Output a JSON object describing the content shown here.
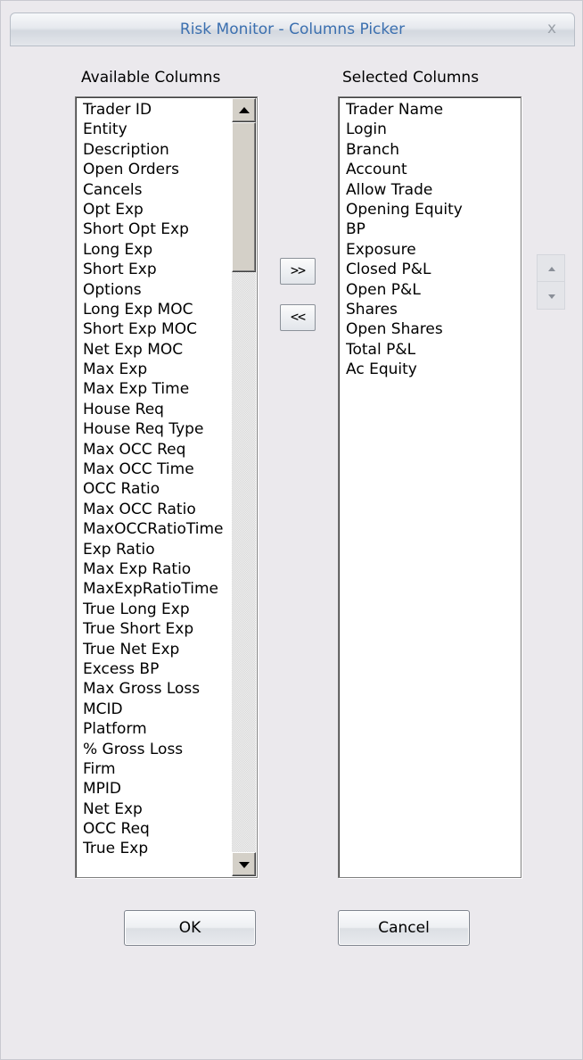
{
  "window": {
    "title": "Risk Monitor - Columns Picker",
    "close_glyph": "x"
  },
  "available": {
    "label": "Available Columns",
    "items": [
      {
        "label": "Trader ID"
      },
      {
        "label": "Entity"
      },
      {
        "label": "Description"
      },
      {
        "label": "Open Orders"
      },
      {
        "label": "Cancels"
      },
      {
        "label": "Opt Exp"
      },
      {
        "label": "Short Opt Exp"
      },
      {
        "label": "Long Exp"
      },
      {
        "label": "Short Exp"
      },
      {
        "label": "Options"
      },
      {
        "label": "Long Exp MOC"
      },
      {
        "label": "Short Exp MOC"
      },
      {
        "label": "Net Exp MOC"
      },
      {
        "label": "Max Exp"
      },
      {
        "label": "Max Exp Time"
      },
      {
        "label": "House Req"
      },
      {
        "label": "House Req Type"
      },
      {
        "label": "Max OCC Req"
      },
      {
        "label": "Max OCC Time"
      },
      {
        "label": "OCC Ratio"
      },
      {
        "label": "Max OCC Ratio"
      },
      {
        "label": "MaxOCCRatioTime"
      },
      {
        "label": "Exp Ratio"
      },
      {
        "label": "Max Exp Ratio"
      },
      {
        "label": "MaxExpRatioTime"
      },
      {
        "label": "True Long Exp"
      },
      {
        "label": "True Short Exp"
      },
      {
        "label": "True Net Exp"
      },
      {
        "label": "Excess BP"
      },
      {
        "label": "Max Gross Loss"
      },
      {
        "label": "MCID"
      },
      {
        "label": "Platform"
      },
      {
        "label": "% Gross Loss"
      },
      {
        "label": "Firm"
      },
      {
        "label": "MPID"
      },
      {
        "label": "Net Exp"
      },
      {
        "label": "OCC Req"
      },
      {
        "label": "True Exp"
      }
    ]
  },
  "selected": {
    "label": "Selected Columns",
    "items": [
      {
        "label": "Trader Name"
      },
      {
        "label": "Login"
      },
      {
        "label": "Branch"
      },
      {
        "label": "Account"
      },
      {
        "label": "Allow Trade"
      },
      {
        "label": "Opening Equity"
      },
      {
        "label": "BP"
      },
      {
        "label": "Exposure"
      },
      {
        "label": "Closed P&L"
      },
      {
        "label": "Open P&L"
      },
      {
        "label": "Shares"
      },
      {
        "label": "Open Shares"
      },
      {
        "label": "Total P&L"
      },
      {
        "label": "Ac Equity"
      }
    ]
  },
  "buttons": {
    "add": ">>",
    "remove": "<<",
    "ok": "OK",
    "cancel": "Cancel"
  },
  "icons": {
    "scroll_up": "triangle-up-icon",
    "scroll_down": "triangle-down-icon",
    "move_up": "triangle-up-icon",
    "move_down": "triangle-down-icon"
  },
  "colors": {
    "title_text": "#3b6faf",
    "dialog_bg": "#ebe9ed",
    "list_bg": "#ffffff"
  }
}
